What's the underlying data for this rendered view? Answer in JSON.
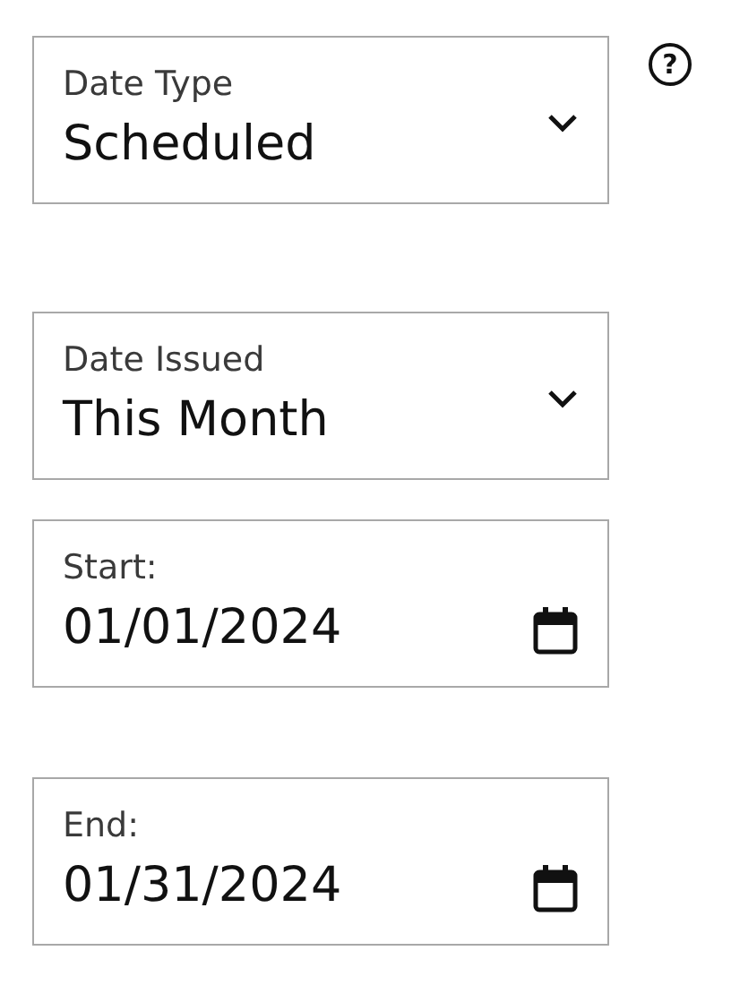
{
  "fields": [
    {
      "kind": "select",
      "label": "Date Type",
      "value": "Scheduled",
      "help": "?"
    },
    {
      "kind": "select",
      "label": "Date Issued",
      "value": "This Month"
    },
    {
      "kind": "date",
      "label": "Start:",
      "value": "01/01/2024"
    },
    {
      "kind": "date",
      "label": "End:",
      "value": "01/31/2024"
    }
  ]
}
